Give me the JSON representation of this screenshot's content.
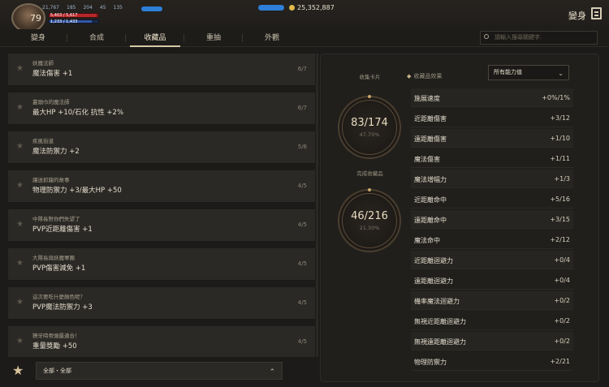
{
  "header": {
    "level": "79",
    "stats": [
      "21,767",
      "185",
      "204",
      "45",
      "135"
    ],
    "hp_label": "5,403 / 5,617",
    "mp_label": "1,233 / 1,433",
    "hp_fraction": 0.96,
    "mp_fraction": 0.86,
    "currency": "25,352,887",
    "page_title": "變身"
  },
  "tabs": [
    {
      "label": "變身"
    },
    {
      "label": "合成"
    },
    {
      "label": "收藏品"
    },
    {
      "label": "重抽"
    },
    {
      "label": "外觀"
    }
  ],
  "search": {
    "placeholder": "請輸入搜尋關鍵字."
  },
  "collections": [
    {
      "subtitle": "妖魔法師",
      "effect": "魔法傷害 +1",
      "count": "6/7"
    },
    {
      "subtitle": "叢頭巾的魔法師",
      "effect": "最大HP +10/石化 抗性 +2%",
      "count": "6/7"
    },
    {
      "subtitle": "疾風街道",
      "effect": "魔法防禦力 +2",
      "count": "5/6"
    },
    {
      "subtitle": "讓送抓龍的故事",
      "effect": "物理防禦力 +3/最大HP +50",
      "count": "4/5"
    },
    {
      "subtitle": "中隊長對你們失望了",
      "effect": "PVP近距離傷害 +1",
      "count": "4/5"
    },
    {
      "subtitle": "大隊長與妖魔軍團",
      "effect": "PVP傷害減免 +1",
      "count": "4/5"
    },
    {
      "subtitle": "這次要吃什麼顏色呢？",
      "effect": "PVP魔法防禦力 +3",
      "count": "4/5"
    },
    {
      "subtitle": "獠牙時骨頭最適合！",
      "effect": "重量獎勵 +50",
      "count": "4/5"
    }
  ],
  "filter": {
    "label": "全部・全部"
  },
  "summary": {
    "cards_caption": "收集卡片",
    "cards_value": "83/174",
    "cards_pct": "47.70%",
    "cards_fraction": 0.477,
    "done_caption": "完成收藏品",
    "done_value": "46/216",
    "done_pct": "21.30%",
    "done_fraction": 0.213
  },
  "effects_header": "收藏品效果",
  "effects_select": "所有能力值",
  "effects": [
    {
      "name": "施展速度",
      "value": "+0%/1%"
    },
    {
      "name": "近距離傷害",
      "value": "+3/12"
    },
    {
      "name": "遠距離傷害",
      "value": "+1/10"
    },
    {
      "name": "魔法傷害",
      "value": "+1/11"
    },
    {
      "name": "魔法增幅力",
      "value": "+1/3"
    },
    {
      "name": "近距離命中",
      "value": "+5/16"
    },
    {
      "name": "遠距離命中",
      "value": "+3/15"
    },
    {
      "name": "魔法命中",
      "value": "+2/12"
    },
    {
      "name": "近距離迴避力",
      "value": "+0/4"
    },
    {
      "name": "遠距離迴避力",
      "value": "+0/4"
    },
    {
      "name": "機率魔法迴避力",
      "value": "+0/2"
    },
    {
      "name": "無視近距離迴避力",
      "value": "+0/2"
    },
    {
      "name": "無視遠距離迴避力",
      "value": "+0/2"
    },
    {
      "name": "物理防禦力",
      "value": "+2/21"
    }
  ]
}
